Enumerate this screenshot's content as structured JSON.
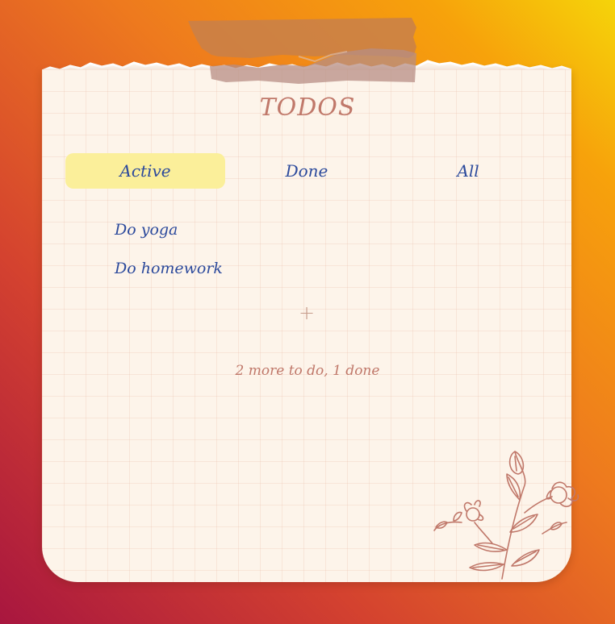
{
  "app": {
    "title": "TODOS"
  },
  "tabs": [
    {
      "label": "Active",
      "selected": true
    },
    {
      "label": "Done",
      "selected": false
    },
    {
      "label": "All",
      "selected": false
    }
  ],
  "todos": [
    {
      "label": "Do yoga"
    },
    {
      "label": "Do homework"
    }
  ],
  "add_button": {
    "label": "+"
  },
  "status": {
    "text": "2 more to do, 1 done"
  },
  "colors": {
    "tab_active_bg": "#fbef9a",
    "text_blue": "#2c4a9c",
    "accent_rose": "#c0786a",
    "paper": "#fdf4ea"
  },
  "decorations": {
    "tape": "masking-tape",
    "flowers": "floral-line-art"
  }
}
